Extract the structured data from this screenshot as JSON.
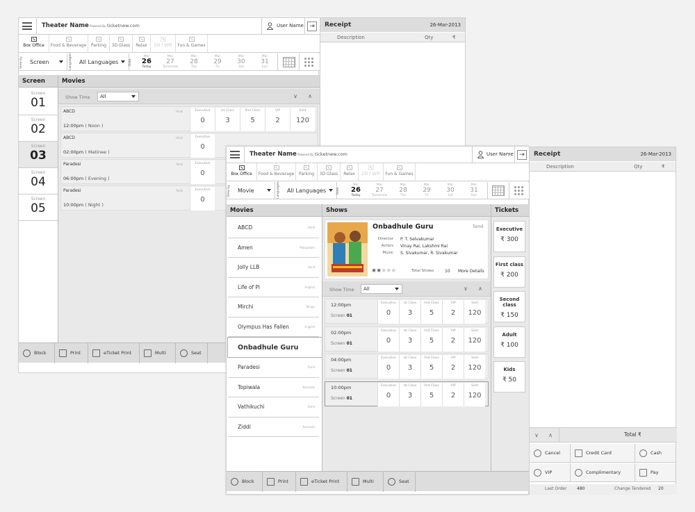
{
  "header": {
    "theater_name": "Theater Name",
    "powered_by": "Powered By",
    "brand": "ticketnew.com",
    "user_name": "User Name"
  },
  "tabs": [
    {
      "label": "Box Office",
      "icon": "box-office-icon",
      "state": "active"
    },
    {
      "label": "Food & Beverage",
      "icon": "food-icon",
      "state": "normal"
    },
    {
      "label": "Parking",
      "icon": "parking-icon",
      "state": "normal"
    },
    {
      "label": "3D Glass",
      "icon": "glasses-icon",
      "state": "normal"
    },
    {
      "label": "Relax",
      "icon": "relax-icon",
      "state": "normal"
    },
    {
      "label": "Zill / Wifi",
      "icon": "wifi-icon",
      "state": "disabled"
    },
    {
      "label": "Fun & Games",
      "icon": "games-icon",
      "state": "normal"
    }
  ],
  "filters_back": {
    "view_by_label": "View by",
    "view_by": "Screen",
    "languages_label": "Languages",
    "languages": "All Languages",
    "date_label": "Date"
  },
  "filters_front": {
    "view_by_label": "View by",
    "view_by": "Movie",
    "languages_label": "Languages",
    "languages": "All Languages",
    "date_label": "Date"
  },
  "dates": [
    {
      "month": "Mar",
      "day": "26",
      "weekday": "Today"
    },
    {
      "month": "Mar",
      "day": "27",
      "weekday": "Tomorrow"
    },
    {
      "month": "Mar",
      "day": "28",
      "weekday": "Thu"
    },
    {
      "month": "Mar",
      "day": "29",
      "weekday": "Fri"
    },
    {
      "month": "Mar",
      "day": "30",
      "weekday": "Sat"
    },
    {
      "month": "Mar",
      "day": "31",
      "weekday": "Sun"
    }
  ],
  "back": {
    "screen_header": "Screen",
    "movies_header": "Movies",
    "screens": [
      {
        "label": "Screen",
        "num": "01"
      },
      {
        "label": "Screen",
        "num": "02"
      },
      {
        "label": "Screen",
        "num": "03"
      },
      {
        "label": "Screen",
        "num": "04"
      },
      {
        "label": "Screen",
        "num": "05"
      }
    ],
    "show_time_label": "Show Time",
    "show_time_value": "All",
    "class_headers": [
      "Executive",
      "Ist Class",
      "IInd Class",
      "VIP",
      "Sold"
    ],
    "shows": [
      {
        "movie": "ABCD",
        "lang": "Hindi",
        "time": "12:00pm",
        "slot": "( Noon )",
        "values": [
          "0",
          "3",
          "5",
          "2",
          "120"
        ]
      },
      {
        "movie": "ABCD",
        "lang": "Hindi",
        "time": "02:00pm",
        "slot": "( Matinee )",
        "values": [
          "0",
          "",
          "",
          "",
          ""
        ]
      },
      {
        "movie": "Paradesi",
        "lang": "Tamil",
        "time": "06:00pm",
        "slot": "( Evening )",
        "values": [
          "0",
          "",
          "",
          "",
          ""
        ]
      },
      {
        "movie": "Paradesi",
        "lang": "Tamil",
        "time": "10:00pm",
        "slot": "( Night )",
        "values": [
          "0",
          "",
          "",
          "",
          ""
        ]
      }
    ],
    "bottom": [
      "Block",
      "Print",
      "eTicket Print",
      "Multi",
      "Seat"
    ]
  },
  "receipt_back": {
    "title": "Receipt",
    "date": "26-Mar-2013",
    "col_desc": "Description",
    "col_qty": "Qty",
    "col_amt": "₹"
  },
  "front": {
    "movies_header": "Movies",
    "shows_header": "Shows",
    "tickets_header": "Tickets",
    "movies": [
      {
        "name": "ABCD",
        "lang": "Hindi"
      },
      {
        "name": "Amen",
        "lang": "Malayalam"
      },
      {
        "name": "Jolly LLB",
        "lang": "Hindi"
      },
      {
        "name": "Life of Pi",
        "lang": "English"
      },
      {
        "name": "Mirchi",
        "lang": "Telugu"
      },
      {
        "name": "Olympus Has Fallen",
        "lang": "English"
      },
      {
        "name": "Onbadhule Guru",
        "lang": ""
      },
      {
        "name": "Paradesi",
        "lang": "Tamil"
      },
      {
        "name": "Topiwala",
        "lang": "Kannada"
      },
      {
        "name": "Vathikuchi",
        "lang": "Tamil"
      },
      {
        "name": "Ziddi",
        "lang": "Kannada"
      }
    ],
    "selected": {
      "title": "Onbadhule Guru",
      "lang": "Tamil",
      "director_label": "Director",
      "director": "P. T. Selvakumar",
      "actors_label": "Actors",
      "actors": "Vinay Rai, Lakshmi Rai",
      "music_label": "Music",
      "music": "S. Sivakumar, R. Sivakumar",
      "rating": 2,
      "total_shows_label": "Total Shows",
      "total_shows": "10",
      "more": "More Details"
    },
    "show_time_label": "Show Time",
    "show_time_value": "All",
    "class_headers": [
      "Executive",
      "Ist Class",
      "IInd Class",
      "VIP",
      "Sold"
    ],
    "shows": [
      {
        "time": "12:00pm",
        "screen_label": "Screen",
        "screen": "01",
        "values": [
          "0",
          "3",
          "5",
          "2",
          "120"
        ]
      },
      {
        "time": "02:00pm",
        "screen_label": "Screen",
        "screen": "01",
        "values": [
          "0",
          "3",
          "5",
          "2",
          "120"
        ]
      },
      {
        "time": "04:00pm",
        "screen_label": "Screen",
        "screen": "01",
        "values": [
          "0",
          "3",
          "5",
          "2",
          "120"
        ]
      },
      {
        "time": "10:00pm",
        "screen_label": "Screen",
        "screen": "01",
        "values": [
          "0",
          "3",
          "5",
          "2",
          "120"
        ]
      }
    ],
    "tickets": [
      {
        "name": "Executive",
        "price": "₹ 300"
      },
      {
        "name": "First class",
        "price": "₹ 200"
      },
      {
        "name": "Second class",
        "price": "₹ 150"
      },
      {
        "name": "Adult",
        "price": "₹ 100"
      },
      {
        "name": "Kids",
        "price": "₹ 50"
      }
    ],
    "bottom": [
      "Block",
      "Print",
      "eTicket Print",
      "Multi",
      "Seat"
    ]
  },
  "receipt_front": {
    "title": "Receipt",
    "date": "26-Mar-2013",
    "col_desc": "Description",
    "col_qty": "Qty",
    "col_amt": "₹",
    "total_label": "Total ₹",
    "buttons": [
      "Cancel",
      "Credit Card",
      "Cash",
      "VIP",
      "Complimentary",
      "Pay"
    ],
    "last_order_label": "Last Order",
    "last_order": "480",
    "change_label": "Change Tendered",
    "change": "20"
  }
}
